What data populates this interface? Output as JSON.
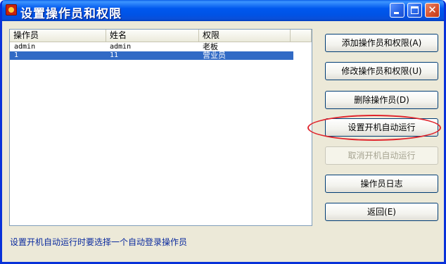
{
  "window": {
    "title": "设置操作员和权限"
  },
  "table": {
    "columns": [
      "操作员",
      "姓名",
      "权限"
    ],
    "rows": [
      {
        "operator": "admin",
        "name": "admin",
        "permission": "老板"
      },
      {
        "operator": "1",
        "name": "11",
        "permission": "营业员"
      }
    ],
    "selected_row": 2
  },
  "buttons": {
    "add": "添加操作员和权限(A)",
    "modify": "修改操作员和权限(U)",
    "delete": "删除操作员(D)",
    "set_autorun": "设置开机自动运行",
    "cancel_autorun": "取消开机自动运行",
    "log": "操作员日志",
    "back": "返回(E)"
  },
  "status_text": "设置开机自动运行时要选择一个自动登录操作员",
  "colors": {
    "selection": "#316ac5",
    "titlebar": "#0058ee",
    "highlight_ring": "#e0242c"
  }
}
